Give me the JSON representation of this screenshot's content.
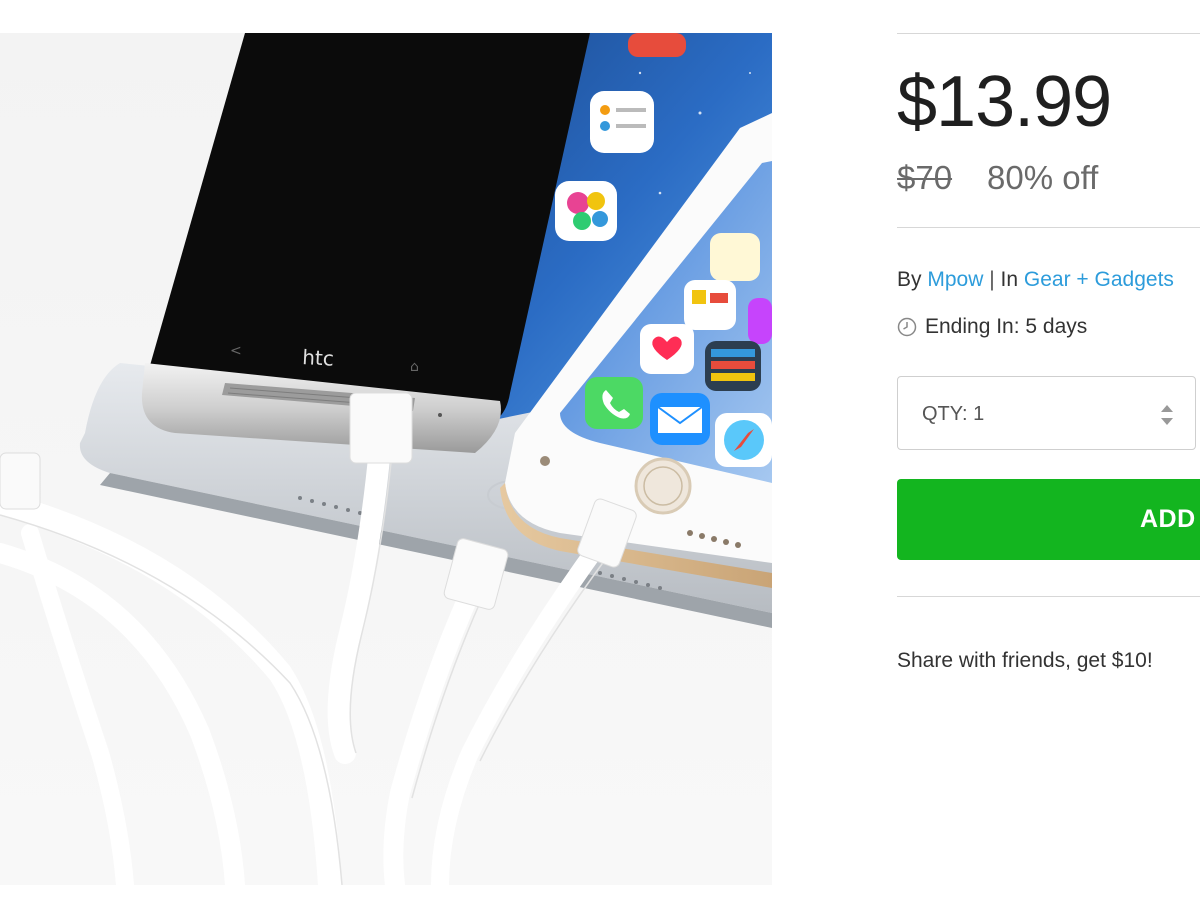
{
  "product": {
    "price": "$13.99",
    "original_price": "$70",
    "discount": "80% off",
    "by_label": "By",
    "vendor": "Mpow",
    "separator": "|",
    "in_label": "In",
    "category": "Gear + Gadgets",
    "ending_label": "Ending In: 5 days",
    "qty_label": "QTY: 1",
    "add_button_label": "ADD",
    "share_text": "Share with friends, get $10!"
  },
  "image": {
    "phone_brand_text": "htc",
    "app_labels": [
      "Photo Booth",
      "Reminders",
      "Game Center",
      "Notes",
      "iTunes Store",
      "Passbook",
      "Health",
      "Phone",
      "Mail",
      "Safari"
    ]
  },
  "colors": {
    "accent_link": "#2d9cdb",
    "buy_button": "#13b51f"
  },
  "icons": {
    "clock": "clock-icon",
    "stepper": "stepper-arrows-icon"
  }
}
